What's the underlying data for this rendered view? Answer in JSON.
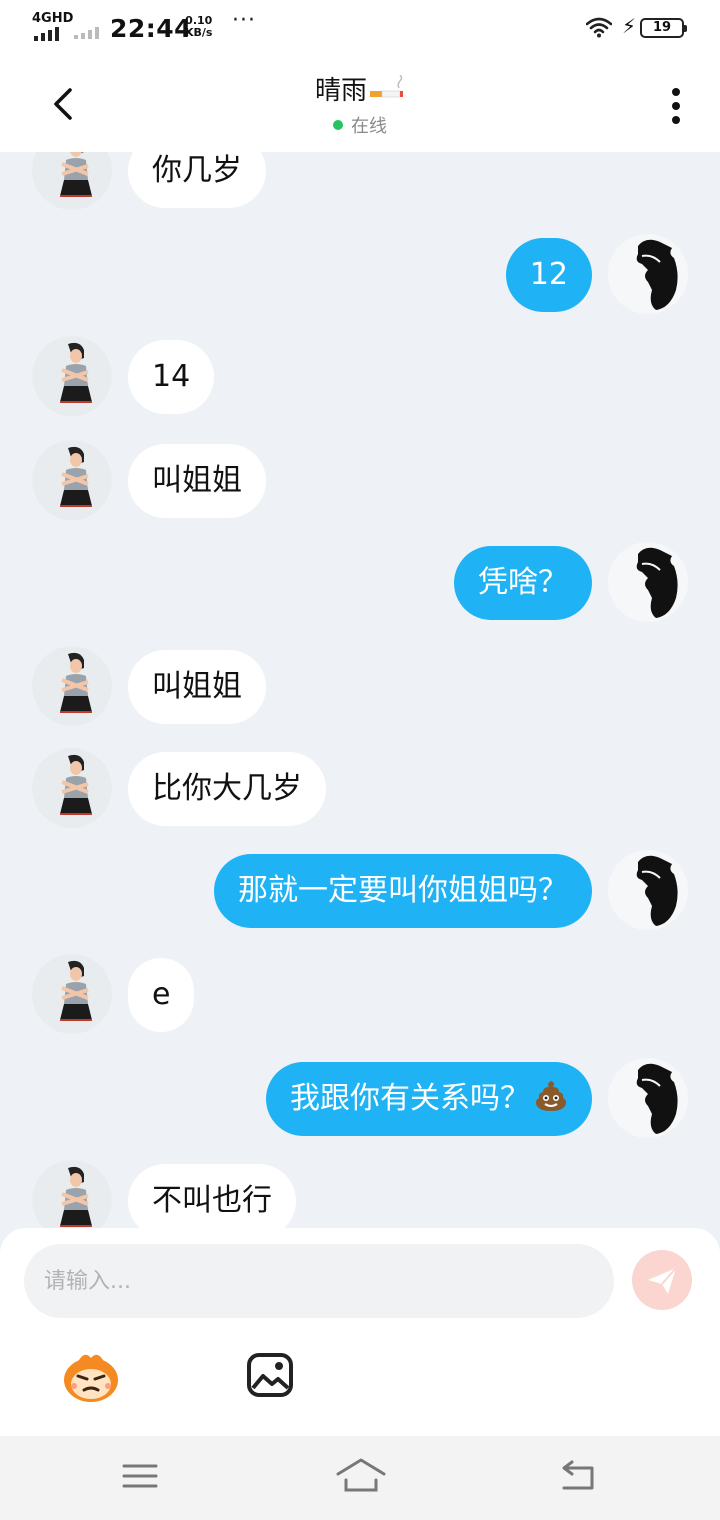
{
  "status_bar": {
    "network": "4GHD",
    "time": "22:44",
    "speed_value": "0.10",
    "speed_unit": "KB/s",
    "more": "···",
    "battery": "19"
  },
  "header": {
    "name": "晴雨",
    "name_emoji_icon": "cigarette-icon",
    "presence": "在线",
    "presence_color": "#22c55e"
  },
  "colors": {
    "outgoing_bubble": "#1fb3f6",
    "incoming_bubble": "#ffffff",
    "chat_background": "#eef2f6",
    "send_button": "#fbd5cf"
  },
  "messages": [
    {
      "side": "in",
      "text": "你几岁"
    },
    {
      "side": "out",
      "text": "12"
    },
    {
      "side": "in",
      "text": "14"
    },
    {
      "side": "in",
      "text": "叫姐姐"
    },
    {
      "side": "out",
      "text": "凭啥？"
    },
    {
      "side": "in",
      "text": "叫姐姐"
    },
    {
      "side": "in",
      "text": "比你大几岁"
    },
    {
      "side": "out",
      "text": "那就一定要叫你姐姐吗？"
    },
    {
      "side": "in",
      "text": "e"
    },
    {
      "side": "out",
      "text": "我跟你有关系吗？",
      "emoji_icon": "poop-icon"
    },
    {
      "side": "in",
      "text": "不叫也行"
    }
  ],
  "composer": {
    "placeholder": "请输入...",
    "value": ""
  }
}
